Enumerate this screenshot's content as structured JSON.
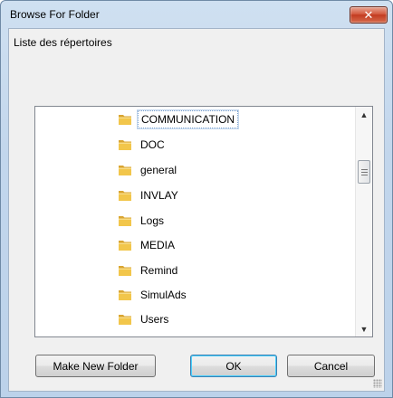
{
  "window": {
    "title": "Browse For Folder",
    "close_symbol": "✕"
  },
  "dialog": {
    "description": "Liste des répertoires"
  },
  "tree": {
    "items": [
      {
        "label": "COMMUNICATION",
        "selected": true,
        "icon": "folder-icon"
      },
      {
        "label": "DOC",
        "icon": "folder-icon"
      },
      {
        "label": "general",
        "icon": "folder-icon"
      },
      {
        "label": "INVLAY",
        "icon": "folder-icon"
      },
      {
        "label": "Logs",
        "icon": "folder-icon"
      },
      {
        "label": "MEDIA",
        "icon": "folder-icon"
      },
      {
        "label": "Remind",
        "icon": "folder-icon"
      },
      {
        "label": "SimulAds",
        "icon": "folder-icon"
      },
      {
        "label": "Users",
        "icon": "folder-icon"
      }
    ],
    "scrollbar": {
      "up_symbol": "▲",
      "down_symbol": "▼"
    }
  },
  "buttons": {
    "make_new_folder": "Make New Folder",
    "ok": "OK",
    "cancel": "Cancel"
  },
  "colors": {
    "folder": "#f2c64b",
    "selection_border": "#7da2ce",
    "close_button": "#c23b20"
  }
}
